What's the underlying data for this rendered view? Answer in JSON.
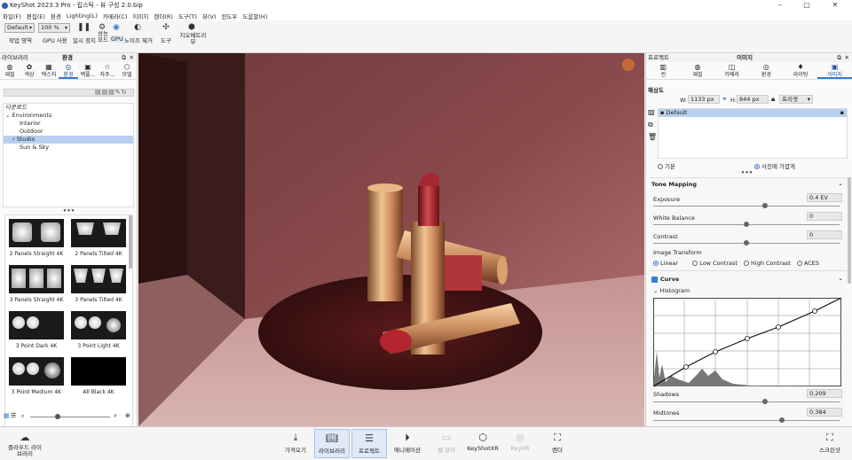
{
  "window": {
    "title": "KeyShot 2023.3 Pro - 립스틱 - 뷰 구성 2.0.bip",
    "minimize": "–",
    "maximize": "▢",
    "close": "✕"
  },
  "menu": [
    "파일(F)",
    "편집(E)",
    "환경",
    "Lighting(L)",
    "카메라(C)",
    "이미지",
    "렌더(R)",
    "도구(T)",
    "뷰(V)",
    "윈도우",
    "도움말(H)"
  ],
  "toolbar": {
    "workspace_select": "Default",
    "zoom_select": "100 %",
    "buttons": [
      "작업 영역",
      "GPU 사용",
      "일시 정지",
      "성능 모드",
      "GPU",
      "노이즈 제거",
      "도구",
      "지오메트리 뷰"
    ]
  },
  "left_panel": {
    "title_left": "라이브러리",
    "title_center": "환경",
    "tabs": [
      {
        "label": "재질",
        "icon": "material-icon"
      },
      {
        "label": "색상",
        "icon": "palette-icon"
      },
      {
        "label": "텍스처",
        "icon": "texture-icon"
      },
      {
        "label": "환경",
        "icon": "environment-icon"
      },
      {
        "label": "백플...",
        "icon": "backplate-icon"
      },
      {
        "label": "자주...",
        "icon": "star-icon"
      },
      {
        "label": "모델",
        "icon": "model-icon"
      }
    ],
    "tree": {
      "downloads": "다운로드",
      "root": "Environments",
      "items": [
        "Interior",
        "Outdoor",
        "Studio",
        "Sun & Sky"
      ],
      "selected": "Studio"
    },
    "more": "•••",
    "thumbnails": [
      {
        "label": "2 Panels Straight 4K"
      },
      {
        "label": "2 Panels Tilted 4K"
      },
      {
        "label": "3 Panels Straight 4K"
      },
      {
        "label": "3 Panels Tilted 4K"
      },
      {
        "label": "3 Point Dark 4K"
      },
      {
        "label": "3 Point Light 4K"
      },
      {
        "label": "3 Point Medium 4K"
      },
      {
        "label": "All Black 4K"
      }
    ]
  },
  "right_panel": {
    "title_left": "프로젝트",
    "title_center": "이미지",
    "tabs": [
      {
        "label": "씬",
        "icon": "scene-icon"
      },
      {
        "label": "재질",
        "icon": "material-icon"
      },
      {
        "label": "카메라",
        "icon": "camera-icon"
      },
      {
        "label": "환경",
        "icon": "environment-icon"
      },
      {
        "label": "라이팅",
        "icon": "lighting-icon"
      },
      {
        "label": "이미지",
        "icon": "image-icon"
      }
    ],
    "resolution_label": "해상도",
    "width_label": "W:",
    "width_value": "1133 px",
    "height_label": "H:",
    "height_value": "844 px",
    "preset": "프리셋",
    "style_default": "Default",
    "mode_basic": "기본",
    "mode_photo": "사진에 가깝게",
    "more": "•••",
    "tone_mapping": "Tone Mapping",
    "exposure_label": "Exposure",
    "exposure_value": "0.4 EV",
    "exposure_level": 0.6,
    "white_balance_label": "White Balance",
    "white_balance_value": "0",
    "white_balance_level": 0.5,
    "contrast_label": "Contrast",
    "contrast_value": "0",
    "contrast_level": 0.5,
    "image_transform_label": "Image Transform",
    "transforms": [
      "Linear",
      "Low Contrast",
      "High Contrast",
      "ACES"
    ],
    "transform_selected": "Linear",
    "curve_label": "Curve",
    "histogram_label": "Histogram",
    "shadows_label": "Shadows",
    "shadows_value": "0.209",
    "shadows_level": 0.6,
    "midtones_label": "Midtones",
    "midtones_value": "0.384",
    "midtones_level": 0.69
  },
  "bottom_bar": {
    "cloud": "클라우드 라이브러리",
    "buttons": [
      {
        "label": "가져오기",
        "icon": "import-icon",
        "state": "normal"
      },
      {
        "label": "라이브러리",
        "icon": "library-icon",
        "state": "active"
      },
      {
        "label": "프로젝트",
        "icon": "project-icon",
        "state": "active"
      },
      {
        "label": "애니메이션",
        "icon": "animation-icon",
        "state": "normal"
      },
      {
        "label": "웹 뷰어",
        "icon": "web-viewer-icon",
        "state": "disabled"
      },
      {
        "label": "KeyShotXR",
        "icon": "keyshotxr-icon",
        "state": "normal"
      },
      {
        "label": "KeyVR",
        "icon": "keyvr-icon",
        "state": "disabled"
      },
      {
        "label": "렌더",
        "icon": "render-icon",
        "state": "normal"
      }
    ],
    "screenshot": "스크린샷"
  },
  "colors": {
    "accent": "#3a7bd5",
    "selection": "#b7cff0",
    "viewport_bg": "#3a1e20"
  }
}
